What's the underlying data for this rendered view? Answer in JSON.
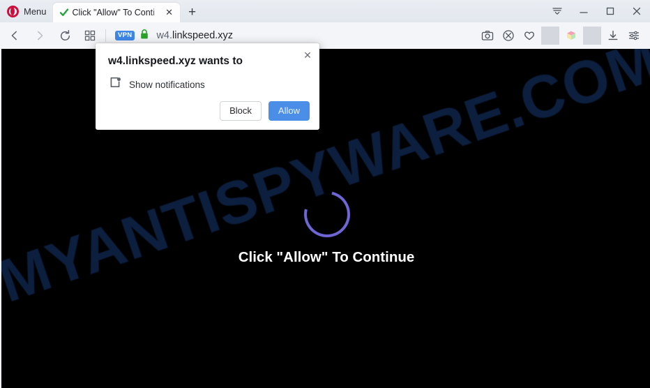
{
  "browser": {
    "name": "Opera",
    "menu_label": "Menu",
    "tabs": [
      {
        "title": "Click \"Allow\" To Conti",
        "favicon": "green-check-icon",
        "close_glyph": "✕"
      }
    ],
    "new_tab_glyph": "+",
    "window_controls": {
      "tab_menu": "tab-list-icon",
      "minimize": "minimize-icon",
      "maximize": "maximize-icon",
      "close": "close-icon"
    },
    "nav": {
      "back": "back-arrow-icon",
      "forward": "forward-arrow-icon",
      "reload": "reload-icon",
      "workspaces": "grid-icon"
    },
    "address": {
      "vpn_badge": "VPN",
      "lock": "green-padlock-icon",
      "url_prefix": "w4.",
      "url_rest": "linkspeed.xyz",
      "url_full": "w4.linkspeed.xyz"
    },
    "toolbar_right": [
      {
        "name": "snapshot-icon",
        "label": "Snapshot"
      },
      {
        "name": "ad-blocker-icon",
        "label": "Ad blocker"
      },
      {
        "name": "heart-icon",
        "label": "Favorites"
      },
      {
        "name": "extension-cube-icon",
        "label": "Extension"
      },
      {
        "name": "downloads-icon",
        "label": "Downloads"
      },
      {
        "name": "easy-setup-icon",
        "label": "Easy setup"
      }
    ]
  },
  "permission_dialog": {
    "title": "w4.linkspeed.xyz wants to",
    "permission_icon": "show-notifications-icon",
    "permission_label": "Show notifications",
    "block_label": "Block",
    "allow_label": "Allow",
    "close_glyph": "✕",
    "allow_color": "#4a8ee8"
  },
  "page": {
    "headline": "Click \"Allow\" To Continue",
    "spinner": "loading-spinner",
    "spinner_color": "#6f67d6",
    "background_color": "#000000",
    "watermark_text": "MYANTISPYWARE.COM",
    "watermark_color": "#0c1f3e"
  }
}
